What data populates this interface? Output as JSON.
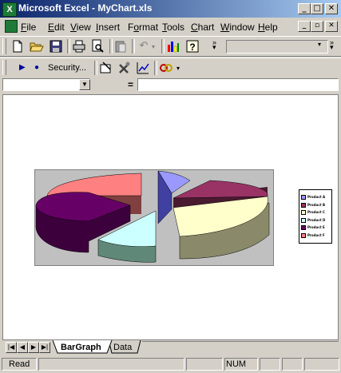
{
  "window": {
    "title": "Microsoft Excel - MyChart.xls",
    "app_icon_glyph": "X"
  },
  "caption_buttons": {
    "minimize": "_",
    "restore": "□",
    "close": "✕"
  },
  "mdi_buttons": {
    "minimize": "_",
    "restore": "▫",
    "close": "✕"
  },
  "menu": [
    {
      "label": "File",
      "key": "F",
      "rest": "ile"
    },
    {
      "label": "Edit",
      "key": "E",
      "rest": "dit"
    },
    {
      "label": "View",
      "key": "V",
      "rest": "iew"
    },
    {
      "label": "Insert",
      "key": "I",
      "rest": "nsert"
    },
    {
      "label": "Format",
      "key": "o",
      "pre": "F",
      "rest": "rmat"
    },
    {
      "label": "Tools",
      "key": "T",
      "rest": "ools"
    },
    {
      "label": "Chart",
      "key": "C",
      "rest": "hart"
    },
    {
      "label": "Window",
      "key": "W",
      "rest": "indow"
    },
    {
      "label": "Help",
      "key": "H",
      "rest": "elp"
    }
  ],
  "toolbar2": {
    "security_label": "Security..."
  },
  "formula_bar": {
    "equals": "="
  },
  "tabs": [
    {
      "label": "BarGraph",
      "active": true
    },
    {
      "label": "Data",
      "active": false
    }
  ],
  "status": {
    "ready_text": "Read",
    "num": "NUM"
  },
  "chart_data": {
    "type": "pie",
    "style": "3d-exploded",
    "categories": [
      "Product A",
      "Product B",
      "Product C",
      "Product D",
      "Product E",
      "Product F"
    ],
    "legend_position": "right",
    "colors": [
      "#9999ff",
      "#993366",
      "#ffffcc",
      "#ccffff",
      "#660066",
      "#ff8080"
    ]
  }
}
